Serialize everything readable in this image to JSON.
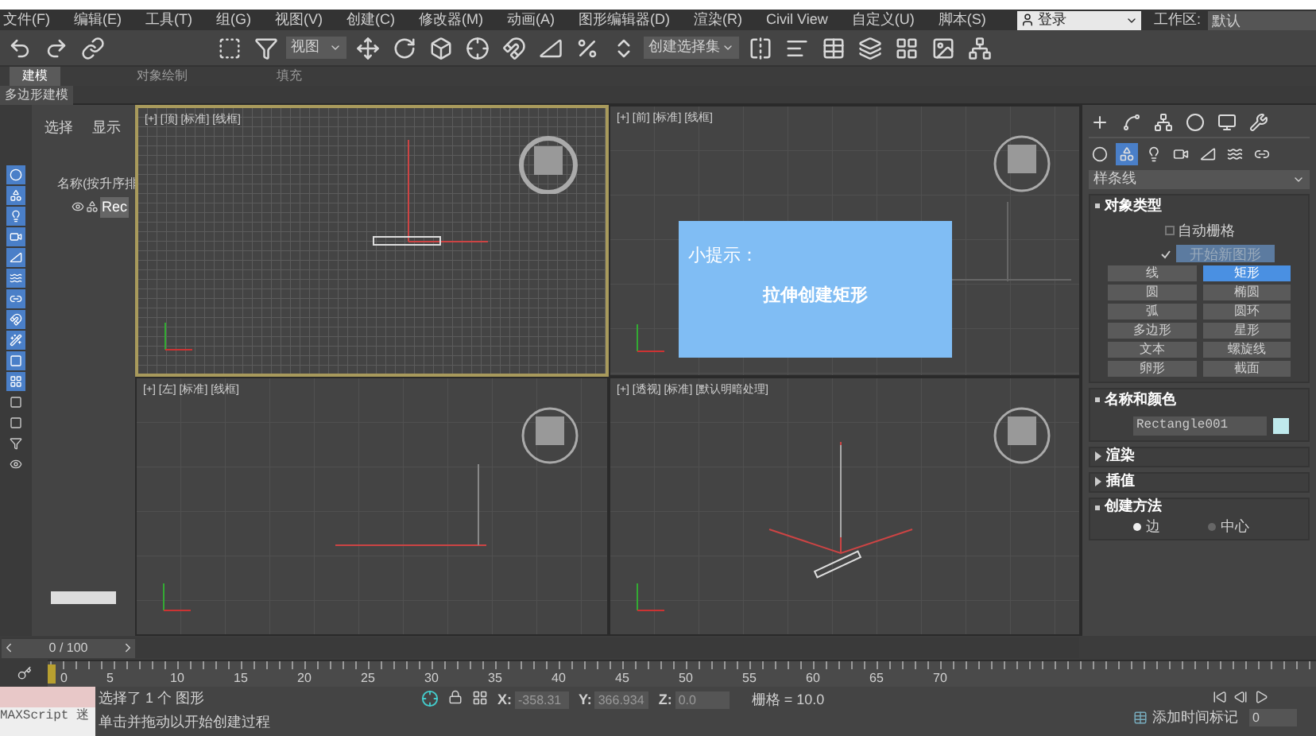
{
  "menu_bar": {
    "items": [
      "文件(F)",
      "编辑(E)",
      "工具(T)",
      "组(G)",
      "视图(V)",
      "创建(C)",
      "修改器(M)",
      "动画(A)",
      "图形编辑器(D)",
      "渲染(R)",
      "Civil View",
      "自定义(U)",
      "脚本(S)"
    ],
    "login": "登录",
    "workspace_label": "工作区:",
    "workspace": "默认"
  },
  "toolbar": {
    "view_dropdown": "视图",
    "selection_set_dropdown": "创建选择集"
  },
  "ribbon": {
    "tabs": [
      {
        "label": "建模",
        "selected": true
      },
      {
        "label": "对象绘制",
        "selected": false
      },
      {
        "label": "填充",
        "selected": false
      }
    ],
    "panel": "多边形建模"
  },
  "scene_explorer": {
    "tabs": [
      "选择",
      "显示"
    ],
    "column": "名称(按升序排",
    "items": [
      {
        "name": "Rec",
        "selected": true
      }
    ]
  },
  "viewports": [
    {
      "label": "[+] [顶] [标准] [线框]",
      "kind": "top",
      "active": true
    },
    {
      "label": "[+] [前] [标准] [线框]",
      "kind": "front",
      "active": false
    },
    {
      "label": "[+] [左] [标准] [线框]",
      "kind": "left",
      "active": false
    },
    {
      "label": "[+] [透视] [标准] [默认明暗处理]",
      "kind": "perspective",
      "active": false
    }
  ],
  "tip": {
    "title": "小提示：",
    "text": "拉伸创建矩形"
  },
  "command_panel": {
    "category": "样条线",
    "object_type": {
      "title": "对象类型",
      "auto_grid": {
        "label": "自动栅格",
        "checked": false
      },
      "start_new_shape": {
        "label": "开始新图形",
        "checked": true
      },
      "buttons": [
        {
          "label": "线",
          "selected": false
        },
        {
          "label": "矩形",
          "selected": true
        },
        {
          "label": "圆",
          "selected": false
        },
        {
          "label": "椭圆",
          "selected": false
        },
        {
          "label": "弧",
          "selected": false
        },
        {
          "label": "圆环",
          "selected": false
        },
        {
          "label": "多边形",
          "selected": false
        },
        {
          "label": "星形",
          "selected": false
        },
        {
          "label": "文本",
          "selected": false
        },
        {
          "label": "螺旋线",
          "selected": false
        },
        {
          "label": "卵形",
          "selected": false
        },
        {
          "label": "截面",
          "selected": false
        }
      ]
    },
    "name_color": {
      "title": "名称和颜色",
      "name": "Rectangle001",
      "color": "#bfe9ec"
    },
    "rollouts": [
      {
        "title": "渲染",
        "expanded": false
      },
      {
        "title": "插值",
        "expanded": false
      },
      {
        "title": "创建方法",
        "expanded": true,
        "options": [
          {
            "label": "边",
            "selected": true
          },
          {
            "label": "中心",
            "selected": false
          }
        ]
      }
    ]
  },
  "time_slider": {
    "reading": "0 / 100",
    "level": 0
  },
  "track": {
    "ticks": [
      "0",
      "5",
      "10",
      "15",
      "20",
      "25",
      "30",
      "35",
      "40",
      "45",
      "50",
      "55",
      "60",
      "65",
      "70"
    ]
  },
  "status": {
    "script_field": "MAXScript 迷",
    "selection": "选择了 1 个 图形",
    "prompt": "单击并拖动以开始创建过程",
    "coords": [
      {
        "label": "X:",
        "value": "-358.31"
      },
      {
        "label": "Y:",
        "value": "366.934"
      },
      {
        "label": "Z:",
        "value": "0.0"
      }
    ],
    "grid": "栅格 = 10.0",
    "time_tag": "添加时间标记",
    "frame": "0"
  }
}
